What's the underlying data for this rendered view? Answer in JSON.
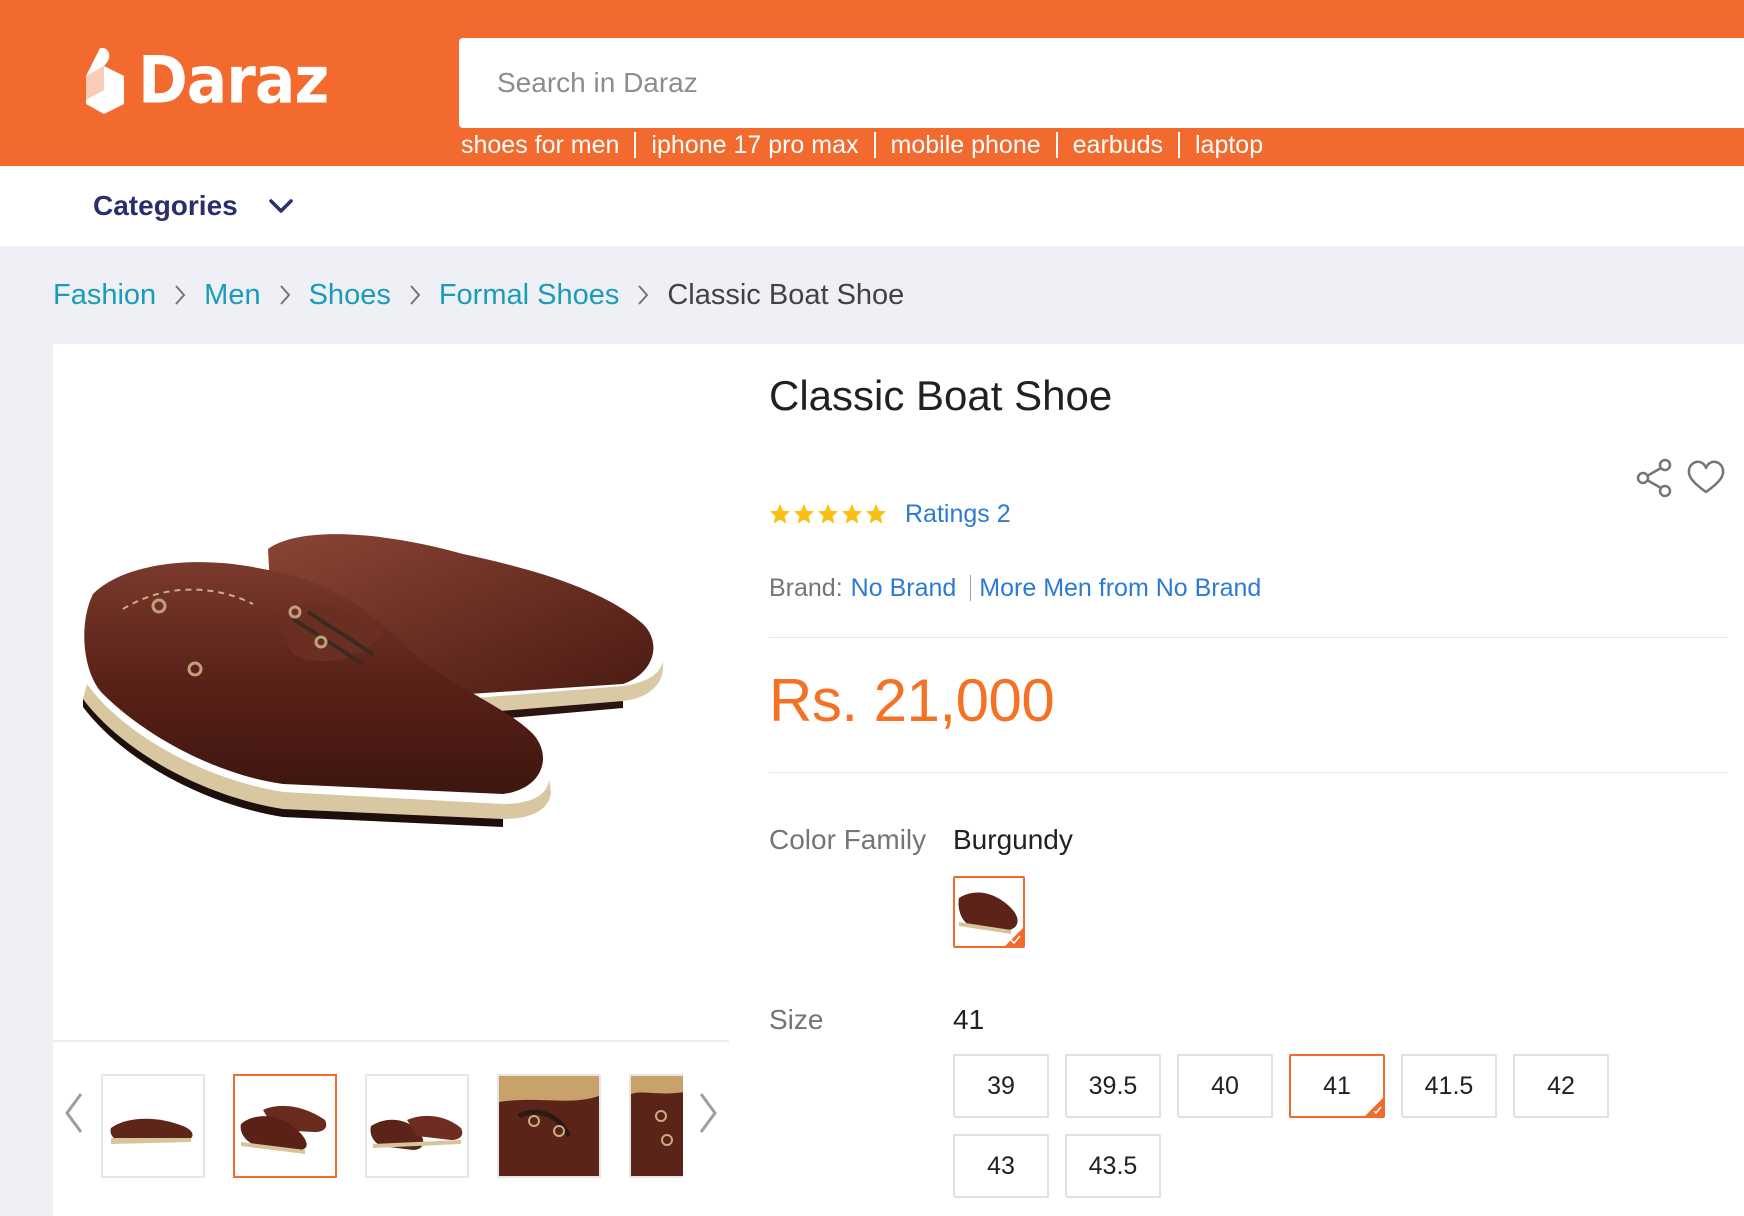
{
  "header": {
    "brand": "Daraz",
    "search": {
      "placeholder": "Search in Daraz",
      "value": ""
    },
    "suggestions": [
      "shoes for men",
      "iphone 17 pro max",
      "mobile phone",
      "earbuds",
      "laptop"
    ],
    "accent_color": "#f26a2e"
  },
  "nav": {
    "categories_label": "Categories"
  },
  "breadcrumb": {
    "items": [
      "Fashion",
      "Men",
      "Shoes",
      "Formal Shoes"
    ],
    "current": "Classic Boat Shoe"
  },
  "product": {
    "title": "Classic Boat Shoe",
    "rating_stars": 5,
    "ratings_text": "Ratings 2",
    "brand_label": "Brand:",
    "brand_value": "No Brand",
    "more_from": "More Men from No Brand",
    "price": "Rs. 21,000",
    "price_color": "#f57224",
    "color_family_label": "Color Family",
    "color_family_value": "Burgundy",
    "size_label": "Size",
    "size_value": "41",
    "sizes": [
      "39",
      "39.5",
      "40",
      "41",
      "41.5",
      "42",
      "43",
      "43.5"
    ],
    "selected_size": "41",
    "gallery_selected_thumb": 2,
    "gallery_thumb_count": 5
  }
}
